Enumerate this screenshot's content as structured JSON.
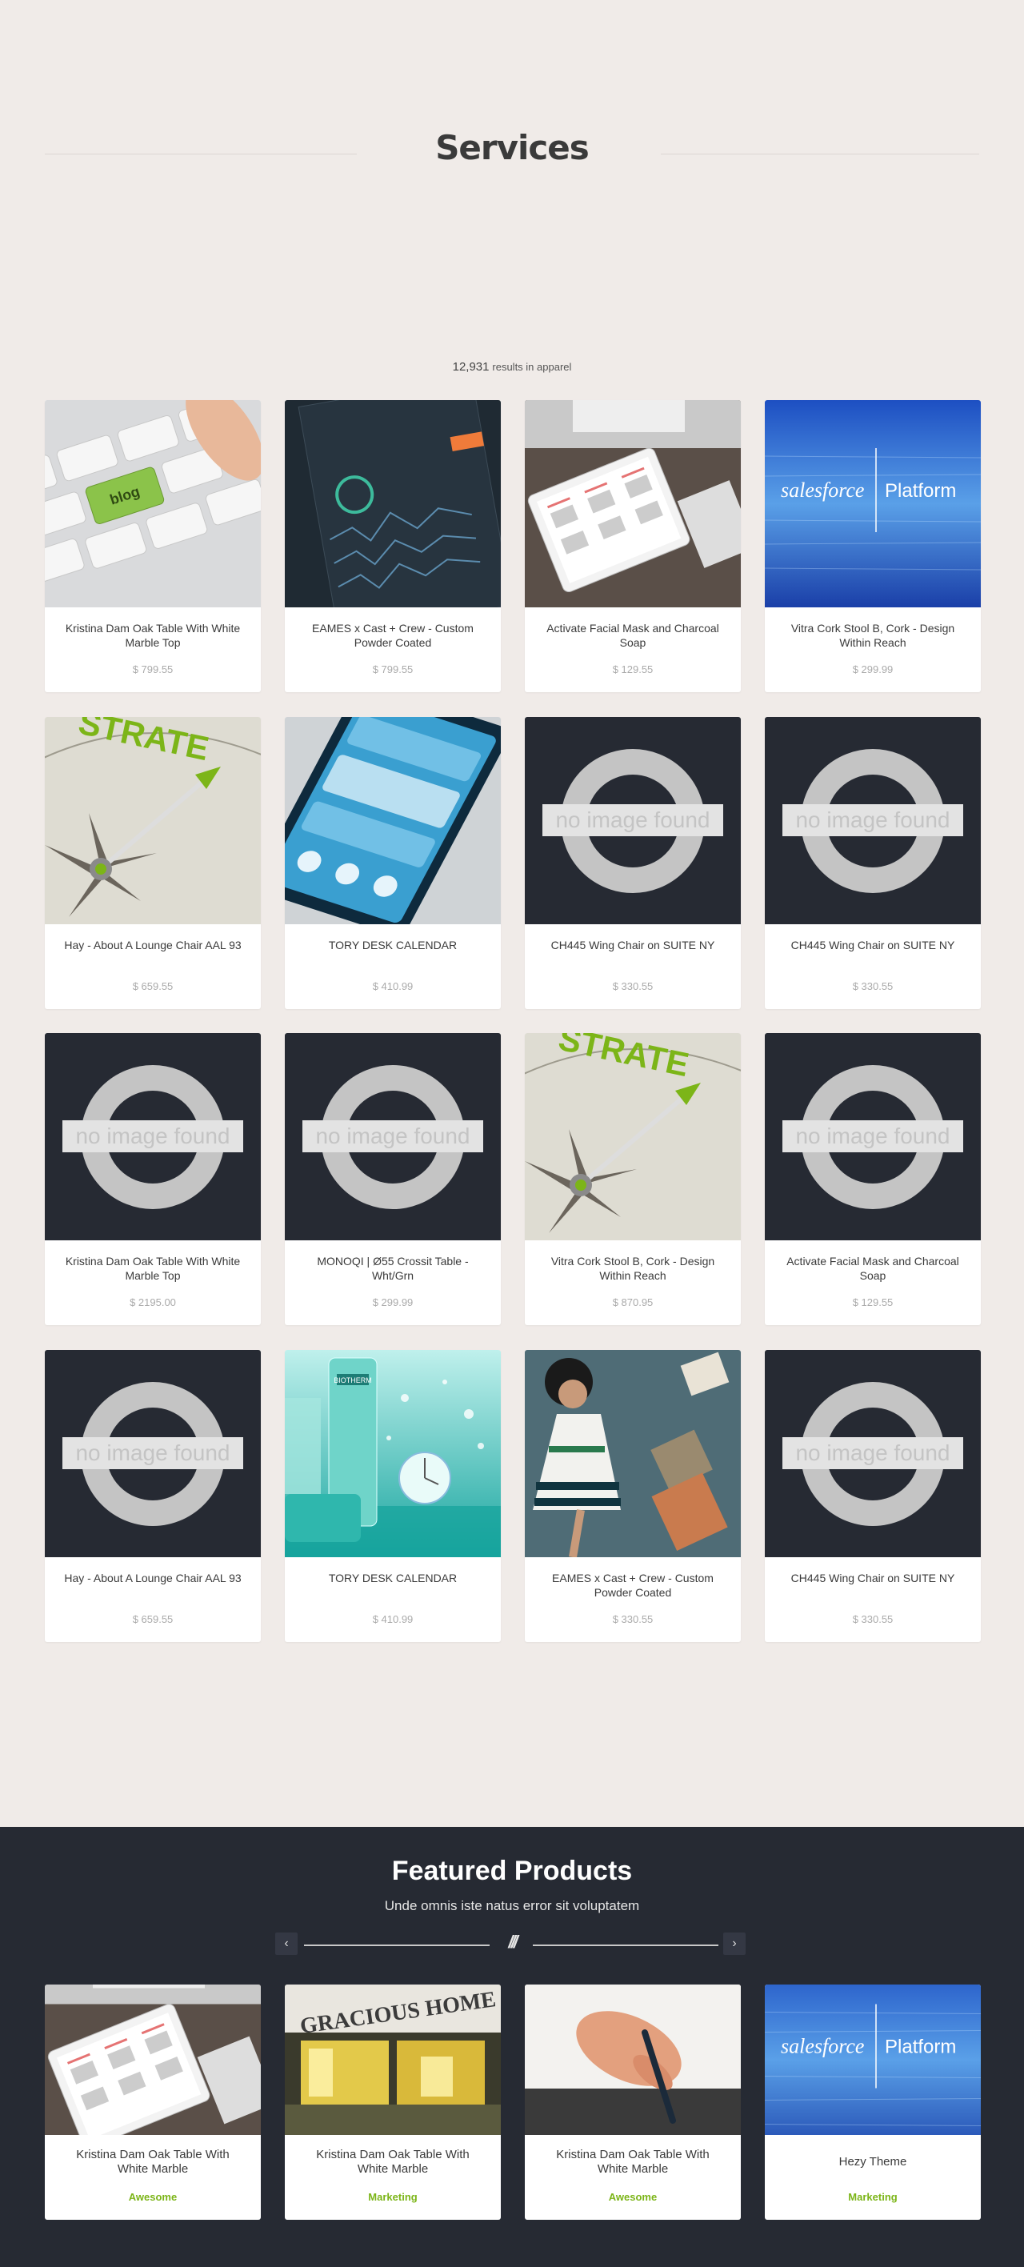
{
  "services": {
    "title": "Services"
  },
  "results": {
    "count": "12,931",
    "label": "results in apparel"
  },
  "noimage_text": "no image found",
  "products": [
    {
      "title": "Kristina Dam Oak Table With White Marble Top",
      "price": "$ 799.55",
      "image": "keyboard-blog"
    },
    {
      "title": "EAMES x Cast + Crew - Custom Powder Coated",
      "price": "$ 799.55",
      "image": "dashboard-app"
    },
    {
      "title": "Activate Facial Mask and Charcoal Soap",
      "price": "$ 129.55",
      "image": "tablet-calendar"
    },
    {
      "title": "Vitra Cork Stool B, Cork - Design Within Reach",
      "price": "$ 299.99",
      "image": "salesforce-platform"
    },
    {
      "title": "Hay - About A Lounge Chair AAL 93",
      "price": "$ 659.55",
      "image": "compass-strategy"
    },
    {
      "title": "TORY DESK CALENDAR",
      "price": "$ 410.99",
      "image": "phone-ui"
    },
    {
      "title": "CH445 Wing Chair on SUITE NY",
      "price": "$ 330.55",
      "image": "none"
    },
    {
      "title": "CH445 Wing Chair on SUITE NY",
      "price": "$ 330.55",
      "image": "none"
    },
    {
      "title": "Kristina Dam Oak Table With White Marble Top",
      "price": "$ 2195.00",
      "image": "none"
    },
    {
      "title": "MONOQI | Ø55 Crossit Table - Wht/Grn",
      "price": "$ 299.99",
      "image": "none"
    },
    {
      "title": "Vitra Cork Stool B, Cork - Design Within Reach",
      "price": "$ 870.95",
      "image": "compass-strategy"
    },
    {
      "title": "Activate Facial Mask and Charcoal Soap",
      "price": "$ 129.55",
      "image": "none"
    },
    {
      "title": "Hay - About A Lounge Chair AAL 93",
      "price": "$ 659.55",
      "image": "none"
    },
    {
      "title": "TORY DESK CALENDAR",
      "price": "$ 410.99",
      "image": "biotherm-cosmetics"
    },
    {
      "title": "EAMES x Cast + Crew - Custom Powder Coated",
      "price": "$ 330.55",
      "image": "woman-dress"
    },
    {
      "title": "CH445 Wing Chair on SUITE NY",
      "price": "$ 330.55",
      "image": "none"
    }
  ],
  "featured": {
    "title": "Featured Products",
    "subtitle": "Unde omnis iste natus error sit voluptatem",
    "prev_icon": "‹",
    "next_icon": "›",
    "divider_mark": "///",
    "items": [
      {
        "title": "Kristina Dam Oak Table With White Marble",
        "tag": "Awesome",
        "image": "tablet-calendar"
      },
      {
        "title": "Kristina Dam Oak Table With White Marble",
        "tag": "Marketing",
        "image": "gracious-home"
      },
      {
        "title": "Kristina Dam Oak Table With White Marble",
        "tag": "Awesome",
        "image": "hand-stylus"
      },
      {
        "title": "Hezy Theme",
        "tag": "Marketing",
        "image": "salesforce-platform"
      }
    ]
  },
  "image_text": {
    "blog_key": "blog",
    "salesforce_left": "salesforce",
    "salesforce_right": "Platform",
    "strategy": "STRATE",
    "gracious": "GRACIOUS HOME",
    "bottle_brand": "BIOTHERM"
  },
  "colors": {
    "page_bg": "#f0ebe8",
    "dark": "#262a33",
    "accent_green": "#7cb518",
    "card_bg": "#ffffff"
  }
}
